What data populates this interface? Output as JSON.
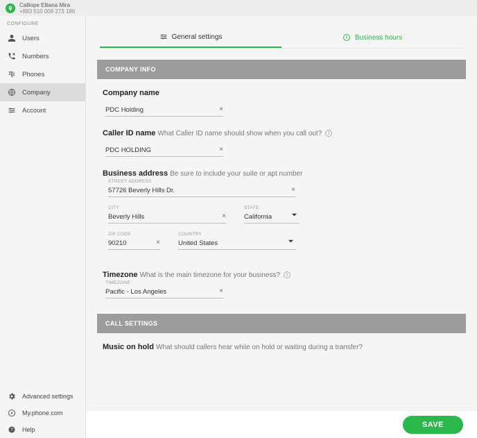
{
  "header": {
    "user_name": "Calliope Elliana Mira",
    "user_phone": "+883 510 008 273 186"
  },
  "sidebar": {
    "configure_label": "CONFIGURE",
    "items": [
      {
        "label": "Users"
      },
      {
        "label": "Numbers"
      },
      {
        "label": "Phones"
      },
      {
        "label": "Company"
      },
      {
        "label": "Account"
      }
    ],
    "bottom": [
      {
        "label": "Advanced settings"
      },
      {
        "label": "My.phone.com"
      },
      {
        "label": "Help"
      }
    ]
  },
  "tabs": {
    "general": "General settings",
    "hours": "Business hours"
  },
  "company_info": {
    "section": "COMPANY INFO",
    "company_name_label": "Company name",
    "company_name_value": "PDC Holding",
    "caller_id_label": "Caller ID name",
    "caller_id_hint": "What Caller ID name should show when you call out?",
    "caller_id_value": "PDC HOLDING",
    "address_label": "Business address",
    "address_hint": "Be sure to include your suite or apt number",
    "street_label": "STREET ADDRESS",
    "street_value": "57726 Beverly Hills Dr.",
    "city_label": "CITY",
    "city_value": "Beverly Hills",
    "state_label": "STATE",
    "state_value": "California",
    "zip_label": "ZIP CODE",
    "zip_value": "90210",
    "country_label": "COUNTRY",
    "country_value": "United States",
    "timezone_label": "Timezone",
    "timezone_hint": "What is the main timezone for your business?",
    "tz_float": "TIMEZONE",
    "tz_value": "Pacific - Los Angeles"
  },
  "call_settings": {
    "section": "CALL SETTINGS",
    "moh_label": "Music on hold",
    "moh_hint": "What should callers hear while on hold or waiting during a transfer?"
  },
  "save": "SAVE"
}
